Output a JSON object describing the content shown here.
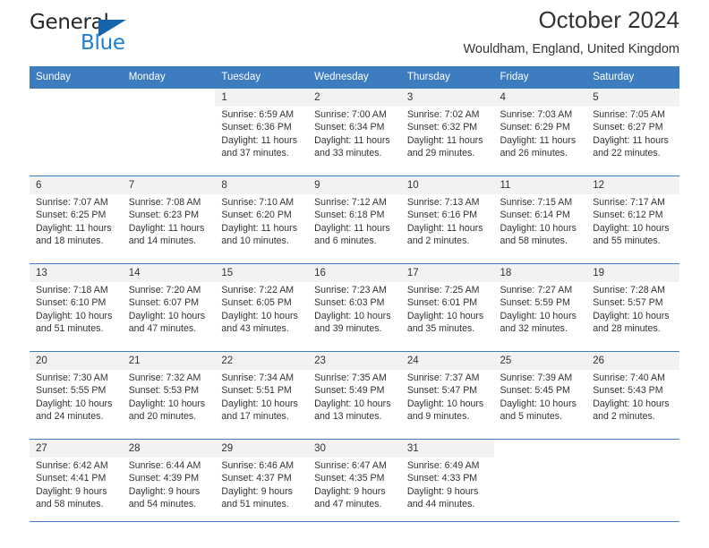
{
  "brand": {
    "name_top": "General",
    "name_bottom": "Blue",
    "triangle_color": "#1565a8",
    "blue_color": "#1b7fd4"
  },
  "header": {
    "title": "October 2024",
    "subtitle": "Wouldham, England, United Kingdom"
  },
  "theme": {
    "header_blue": "#3c7cbf",
    "daynum_background": "#f2f2f2",
    "text_color": "#333333"
  },
  "calendar": {
    "weekday_headers": [
      "Sunday",
      "Monday",
      "Tuesday",
      "Wednesday",
      "Thursday",
      "Friday",
      "Saturday"
    ],
    "weeks": [
      [
        {
          "day": "",
          "lines": []
        },
        {
          "day": "",
          "lines": []
        },
        {
          "day": "1",
          "lines": [
            "Sunrise: 6:59 AM",
            "Sunset: 6:36 PM",
            "Daylight: 11 hours",
            "and 37 minutes."
          ]
        },
        {
          "day": "2",
          "lines": [
            "Sunrise: 7:00 AM",
            "Sunset: 6:34 PM",
            "Daylight: 11 hours",
            "and 33 minutes."
          ]
        },
        {
          "day": "3",
          "lines": [
            "Sunrise: 7:02 AM",
            "Sunset: 6:32 PM",
            "Daylight: 11 hours",
            "and 29 minutes."
          ]
        },
        {
          "day": "4",
          "lines": [
            "Sunrise: 7:03 AM",
            "Sunset: 6:29 PM",
            "Daylight: 11 hours",
            "and 26 minutes."
          ]
        },
        {
          "day": "5",
          "lines": [
            "Sunrise: 7:05 AM",
            "Sunset: 6:27 PM",
            "Daylight: 11 hours",
            "and 22 minutes."
          ]
        }
      ],
      [
        {
          "day": "6",
          "lines": [
            "Sunrise: 7:07 AM",
            "Sunset: 6:25 PM",
            "Daylight: 11 hours",
            "and 18 minutes."
          ]
        },
        {
          "day": "7",
          "lines": [
            "Sunrise: 7:08 AM",
            "Sunset: 6:23 PM",
            "Daylight: 11 hours",
            "and 14 minutes."
          ]
        },
        {
          "day": "8",
          "lines": [
            "Sunrise: 7:10 AM",
            "Sunset: 6:20 PM",
            "Daylight: 11 hours",
            "and 10 minutes."
          ]
        },
        {
          "day": "9",
          "lines": [
            "Sunrise: 7:12 AM",
            "Sunset: 6:18 PM",
            "Daylight: 11 hours",
            "and 6 minutes."
          ]
        },
        {
          "day": "10",
          "lines": [
            "Sunrise: 7:13 AM",
            "Sunset: 6:16 PM",
            "Daylight: 11 hours",
            "and 2 minutes."
          ]
        },
        {
          "day": "11",
          "lines": [
            "Sunrise: 7:15 AM",
            "Sunset: 6:14 PM",
            "Daylight: 10 hours",
            "and 58 minutes."
          ]
        },
        {
          "day": "12",
          "lines": [
            "Sunrise: 7:17 AM",
            "Sunset: 6:12 PM",
            "Daylight: 10 hours",
            "and 55 minutes."
          ]
        }
      ],
      [
        {
          "day": "13",
          "lines": [
            "Sunrise: 7:18 AM",
            "Sunset: 6:10 PM",
            "Daylight: 10 hours",
            "and 51 minutes."
          ]
        },
        {
          "day": "14",
          "lines": [
            "Sunrise: 7:20 AM",
            "Sunset: 6:07 PM",
            "Daylight: 10 hours",
            "and 47 minutes."
          ]
        },
        {
          "day": "15",
          "lines": [
            "Sunrise: 7:22 AM",
            "Sunset: 6:05 PM",
            "Daylight: 10 hours",
            "and 43 minutes."
          ]
        },
        {
          "day": "16",
          "lines": [
            "Sunrise: 7:23 AM",
            "Sunset: 6:03 PM",
            "Daylight: 10 hours",
            "and 39 minutes."
          ]
        },
        {
          "day": "17",
          "lines": [
            "Sunrise: 7:25 AM",
            "Sunset: 6:01 PM",
            "Daylight: 10 hours",
            "and 35 minutes."
          ]
        },
        {
          "day": "18",
          "lines": [
            "Sunrise: 7:27 AM",
            "Sunset: 5:59 PM",
            "Daylight: 10 hours",
            "and 32 minutes."
          ]
        },
        {
          "day": "19",
          "lines": [
            "Sunrise: 7:28 AM",
            "Sunset: 5:57 PM",
            "Daylight: 10 hours",
            "and 28 minutes."
          ]
        }
      ],
      [
        {
          "day": "20",
          "lines": [
            "Sunrise: 7:30 AM",
            "Sunset: 5:55 PM",
            "Daylight: 10 hours",
            "and 24 minutes."
          ]
        },
        {
          "day": "21",
          "lines": [
            "Sunrise: 7:32 AM",
            "Sunset: 5:53 PM",
            "Daylight: 10 hours",
            "and 20 minutes."
          ]
        },
        {
          "day": "22",
          "lines": [
            "Sunrise: 7:34 AM",
            "Sunset: 5:51 PM",
            "Daylight: 10 hours",
            "and 17 minutes."
          ]
        },
        {
          "day": "23",
          "lines": [
            "Sunrise: 7:35 AM",
            "Sunset: 5:49 PM",
            "Daylight: 10 hours",
            "and 13 minutes."
          ]
        },
        {
          "day": "24",
          "lines": [
            "Sunrise: 7:37 AM",
            "Sunset: 5:47 PM",
            "Daylight: 10 hours",
            "and 9 minutes."
          ]
        },
        {
          "day": "25",
          "lines": [
            "Sunrise: 7:39 AM",
            "Sunset: 5:45 PM",
            "Daylight: 10 hours",
            "and 5 minutes."
          ]
        },
        {
          "day": "26",
          "lines": [
            "Sunrise: 7:40 AM",
            "Sunset: 5:43 PM",
            "Daylight: 10 hours",
            "and 2 minutes."
          ]
        }
      ],
      [
        {
          "day": "27",
          "lines": [
            "Sunrise: 6:42 AM",
            "Sunset: 4:41 PM",
            "Daylight: 9 hours",
            "and 58 minutes."
          ]
        },
        {
          "day": "28",
          "lines": [
            "Sunrise: 6:44 AM",
            "Sunset: 4:39 PM",
            "Daylight: 9 hours",
            "and 54 minutes."
          ]
        },
        {
          "day": "29",
          "lines": [
            "Sunrise: 6:46 AM",
            "Sunset: 4:37 PM",
            "Daylight: 9 hours",
            "and 51 minutes."
          ]
        },
        {
          "day": "30",
          "lines": [
            "Sunrise: 6:47 AM",
            "Sunset: 4:35 PM",
            "Daylight: 9 hours",
            "and 47 minutes."
          ]
        },
        {
          "day": "31",
          "lines": [
            "Sunrise: 6:49 AM",
            "Sunset: 4:33 PM",
            "Daylight: 9 hours",
            "and 44 minutes."
          ]
        },
        {
          "day": "",
          "lines": []
        },
        {
          "day": "",
          "lines": []
        }
      ]
    ]
  }
}
